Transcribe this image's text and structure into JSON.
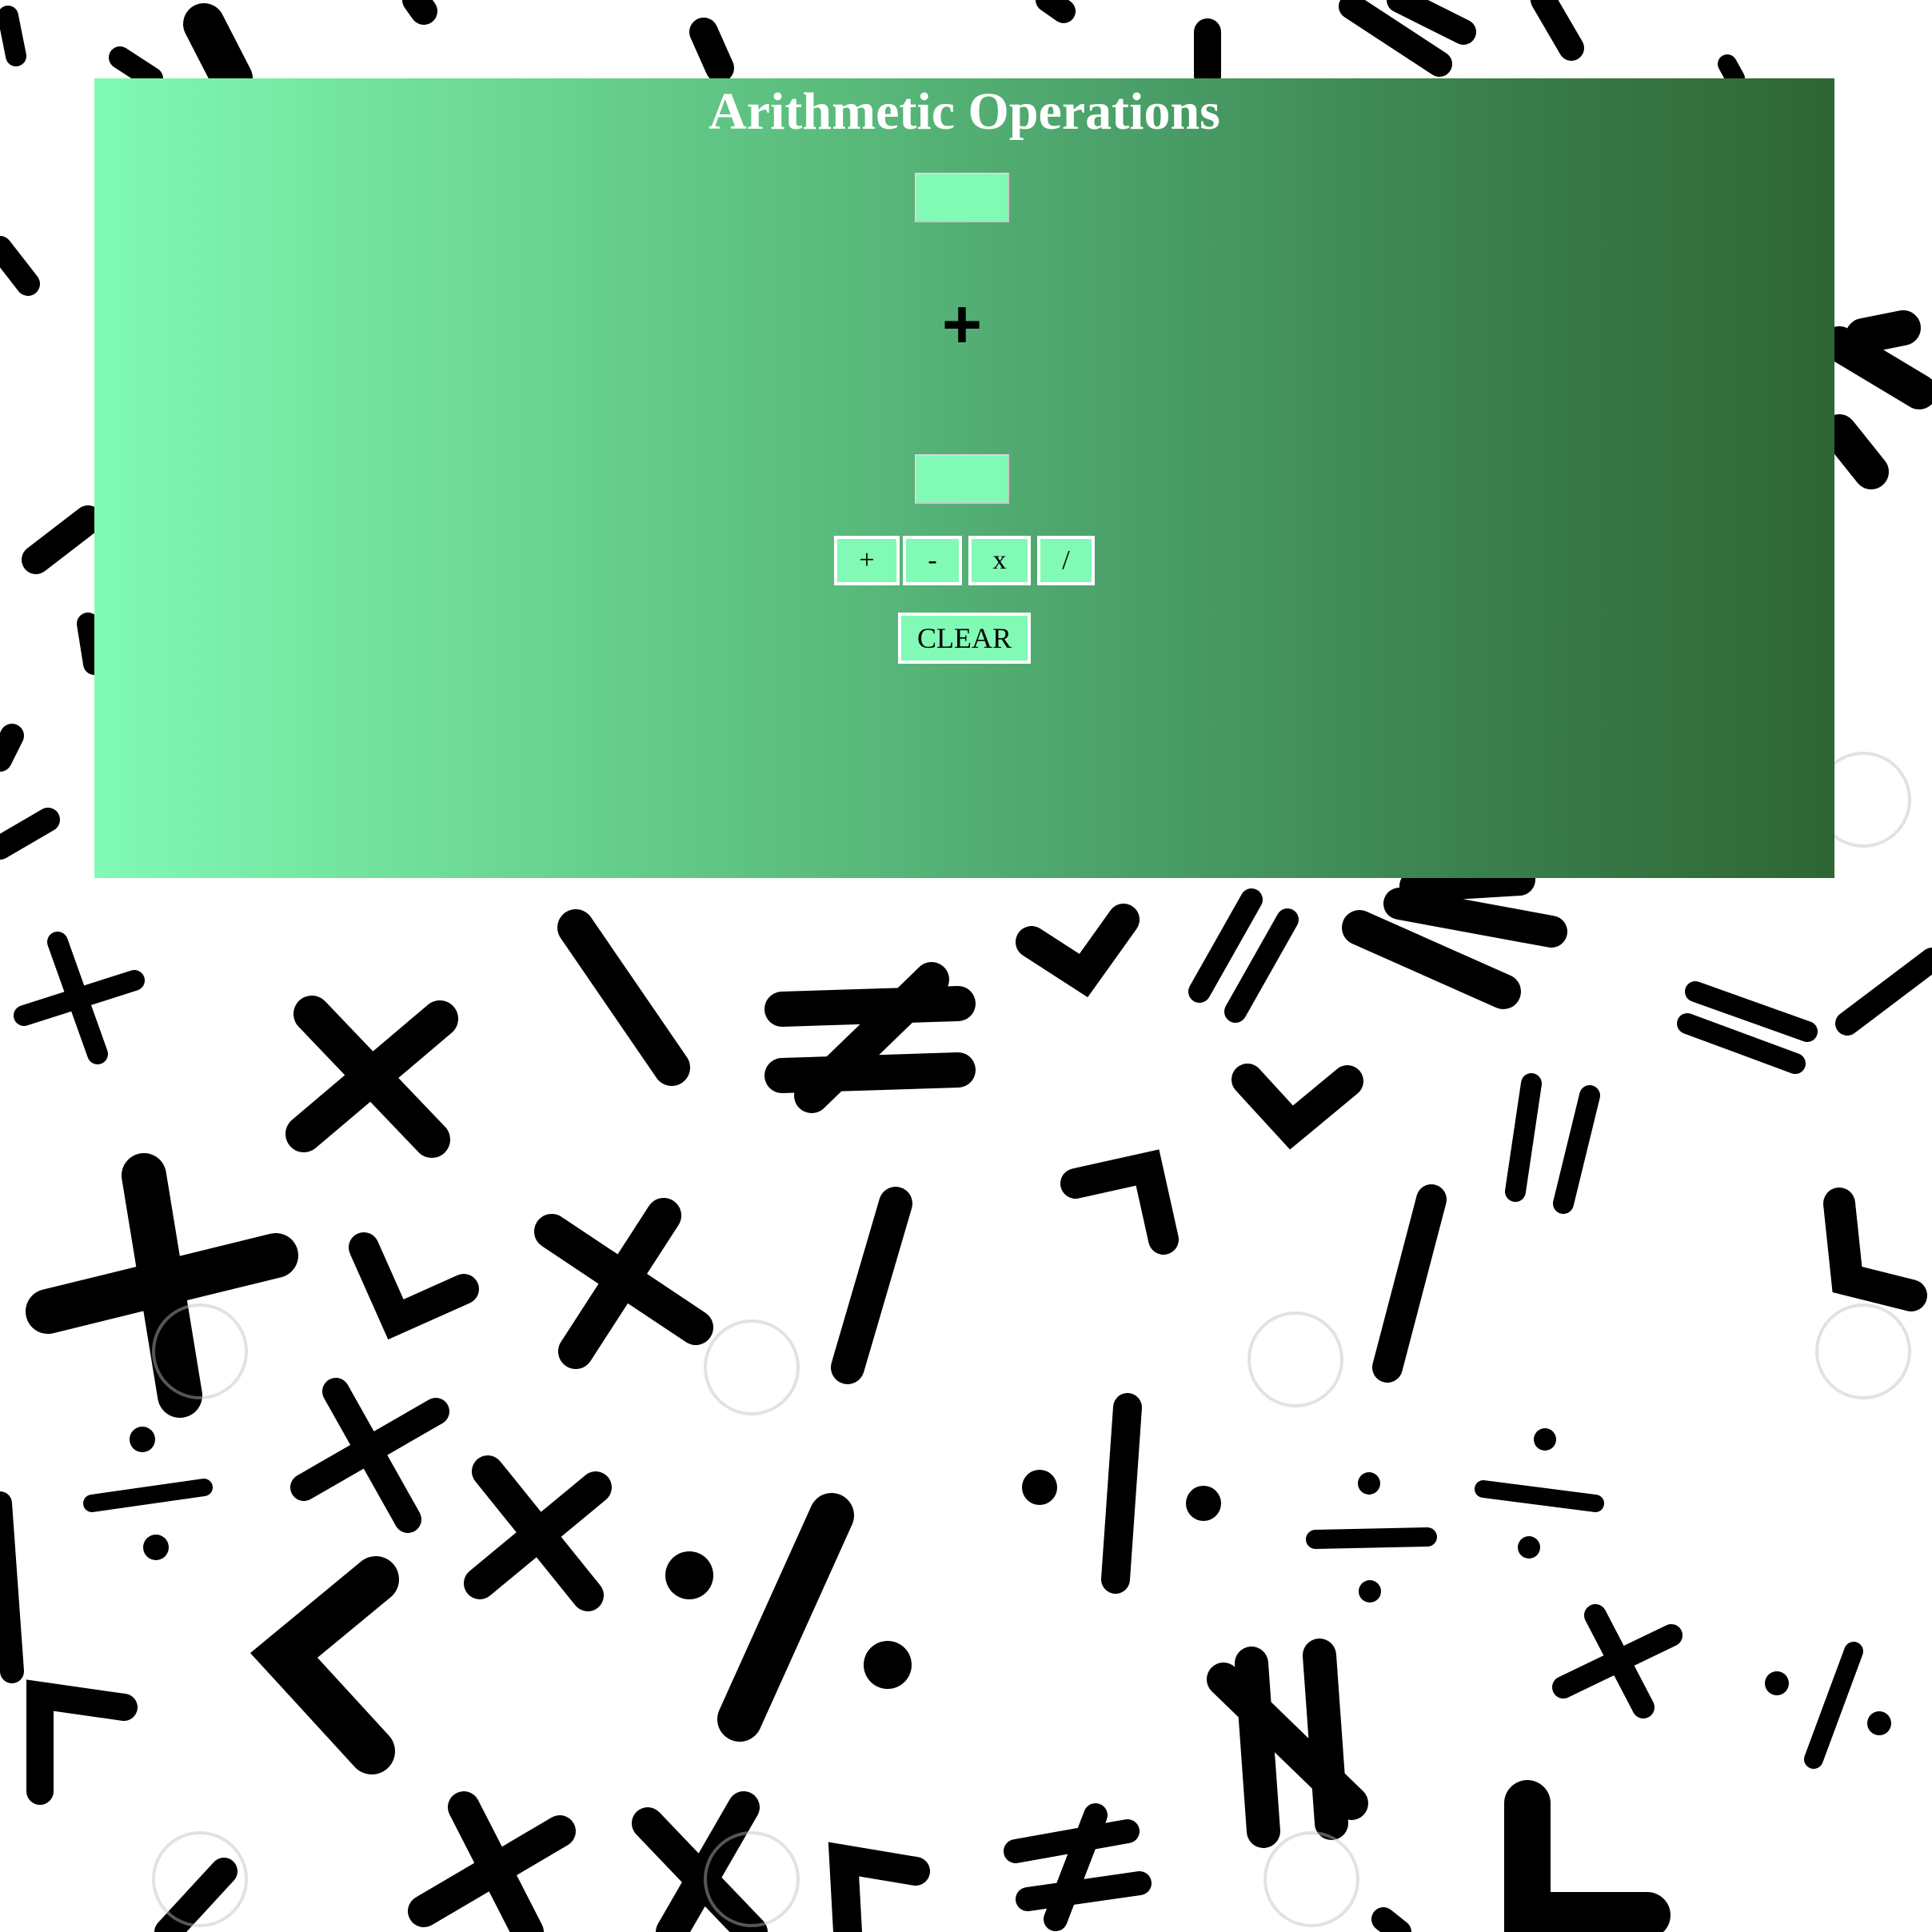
{
  "app": {
    "title": "Arithmetic Operations"
  },
  "inputs": {
    "first_value": "",
    "second_value": ""
  },
  "operation": {
    "current_symbol": "+"
  },
  "buttons": {
    "add": "+",
    "subtract": "-",
    "multiply": "x",
    "divide": "/",
    "clear": "CLEAR"
  },
  "colors": {
    "panel_gradient_start": "#80fab5",
    "panel_gradient_end": "#2e6634",
    "button_background": "#80fab5",
    "title_color": "#ffffff",
    "background_symbols": "#000000"
  },
  "background": {
    "pattern": "math-symbols",
    "icons": [
      "plus-icon",
      "minus-icon",
      "times-icon",
      "divide-icon",
      "equals-icon",
      "not-equal-icon",
      "less-than-icon",
      "greater-than-icon",
      "watermark-camera-icon"
    ]
  }
}
